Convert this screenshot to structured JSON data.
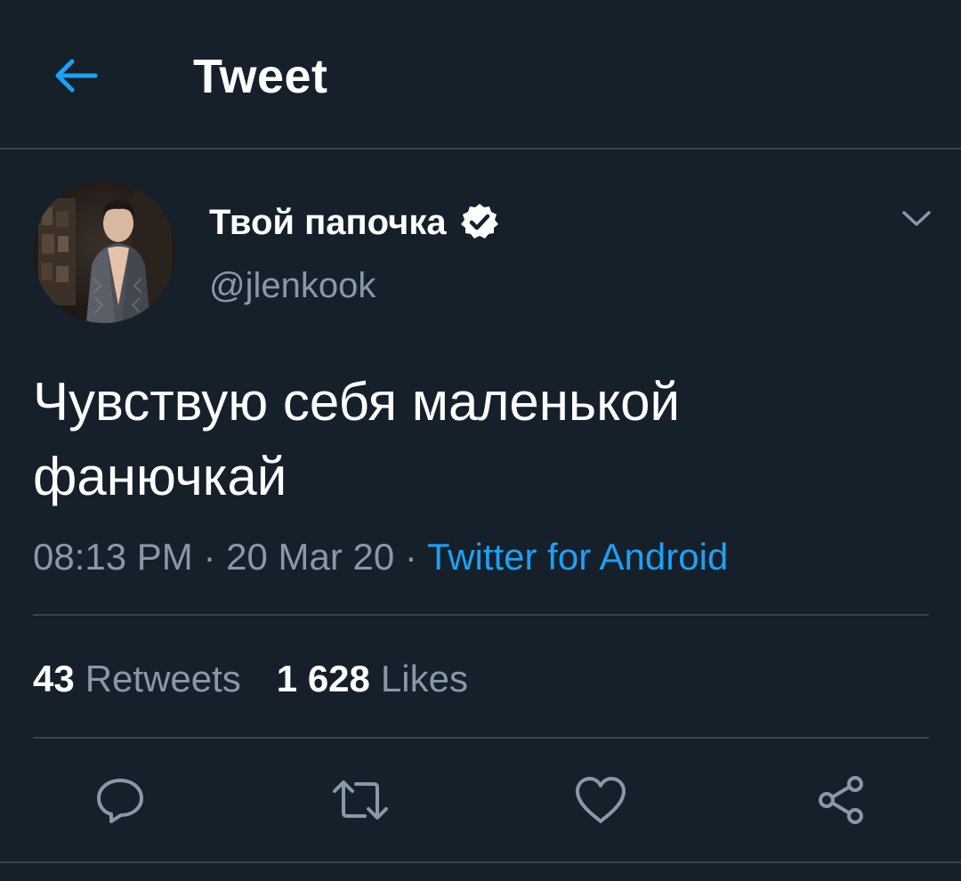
{
  "header": {
    "title": "Tweet",
    "back_icon": "arrow-left-icon",
    "accent_color": "#1da1f2"
  },
  "author": {
    "display_name": "Твой папочка",
    "handle": "@jlenkook",
    "verified": true,
    "verified_icon": "verified-badge-icon"
  },
  "tweet": {
    "text": "Чувствую себя маленькой фанючкай",
    "time": "08:13 PM",
    "date": "20 Mar 20",
    "separator": "·",
    "source": "Twitter for Android"
  },
  "stats": {
    "retweets_count": "43",
    "retweets_label": "Retweets",
    "likes_count": "1 628",
    "likes_label": "Likes"
  },
  "actions": [
    {
      "name": "reply",
      "icon": "reply-icon"
    },
    {
      "name": "retweet",
      "icon": "retweet-icon"
    },
    {
      "name": "like",
      "icon": "heart-icon"
    },
    {
      "name": "share",
      "icon": "share-icon"
    }
  ],
  "colors": {
    "background": "#15202b",
    "secondary_text": "#8899a6",
    "divider": "#38444d",
    "link": "#1da1f2"
  }
}
